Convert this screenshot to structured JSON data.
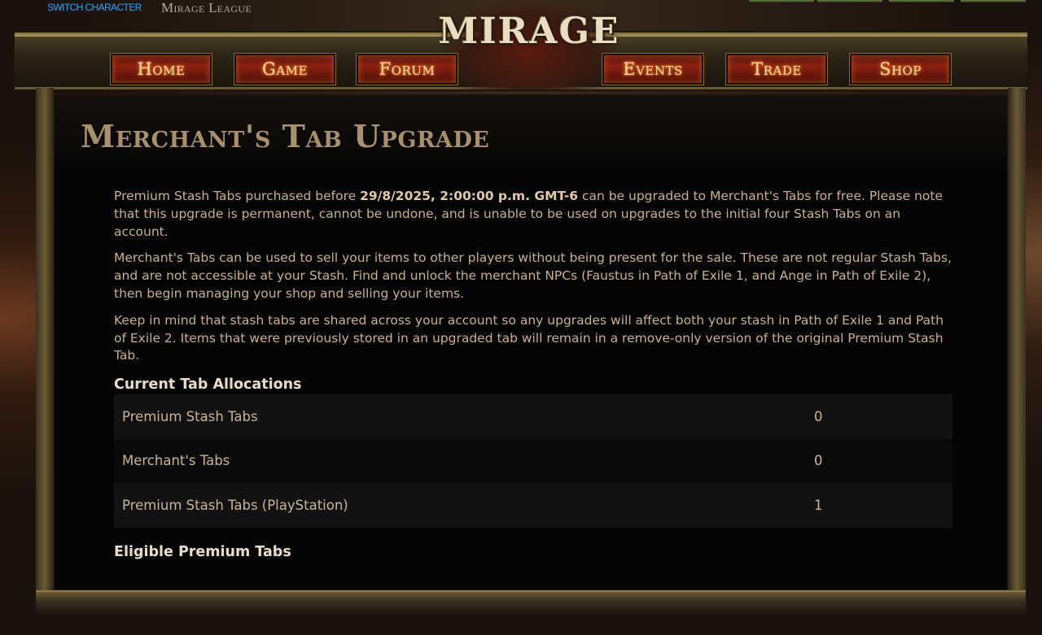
{
  "topbar": {
    "switch_character": "SWITCH CHARACTER",
    "league": "Mirage League"
  },
  "header": {
    "logo_text": "MIRAGE",
    "nav": [
      {
        "label": "Home"
      },
      {
        "label": "Game"
      },
      {
        "label": "Forum"
      },
      {
        "label": "Events"
      },
      {
        "label": "Trade"
      },
      {
        "label": "Shop"
      }
    ]
  },
  "page": {
    "title": "Merchant's Tab Upgrade",
    "para1_a": "Premium Stash Tabs purchased before ",
    "para1_date": "29/8/2025, 2:00:00 p.m. GMT-6",
    "para1_b": " can be upgraded to Merchant's Tabs for free. Please note that this upgrade is permanent, cannot be undone, and is unable to be used on upgrades to the initial four Stash Tabs on an account.",
    "para2": "Merchant's Tabs can be used to sell your items to other players without being present for the sale. These are not regular Stash Tabs, and are not accessible at your Stash. Find and unlock the merchant NPCs (Faustus in Path of Exile 1, and Ange in Path of Exile 2), then begin managing your shop and selling your items.",
    "para3": "Keep in mind that stash tabs are shared across your account so any upgrades will affect both your stash in Path of Exile 1 and Path of Exile 2. Items that were previously stored in an upgraded tab will remain in a remove-only version of the original Premium Stash Tab.",
    "allocations_heading": "Current Tab Allocations",
    "allocations": [
      {
        "label": "Premium Stash Tabs",
        "value": "0"
      },
      {
        "label": "Merchant's Tabs",
        "value": "0"
      },
      {
        "label": "Premium Stash Tabs (PlayStation)",
        "value": "1"
      }
    ],
    "eligible_heading": "Eligible Premium Tabs"
  },
  "colors": {
    "accent_link": "#2aa7ff",
    "title": "#a8916a",
    "body_text": "#c9b18a",
    "heading": "#e8dcc6",
    "nav_glow": "#ff7a20"
  }
}
